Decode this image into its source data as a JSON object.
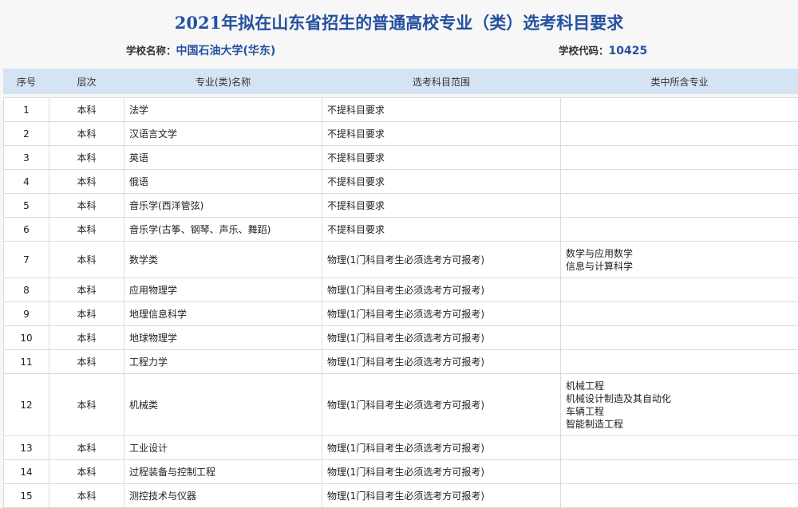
{
  "title": "2021年拟在山东省招生的普通高校专业（类）选考科目要求",
  "school": {
    "name_label": "学校名称：",
    "name": "中国石油大学(华东)",
    "code_label": "学校代码：",
    "code": "10425"
  },
  "headers": [
    "序号",
    "层次",
    "专业(类)名称",
    "选考科目范围",
    "类中所含专业"
  ],
  "rows": [
    {
      "no": "1",
      "level": "本科",
      "major": "法学",
      "req": "不提科目要求",
      "subs": []
    },
    {
      "no": "2",
      "level": "本科",
      "major": "汉语言文学",
      "req": "不提科目要求",
      "subs": []
    },
    {
      "no": "3",
      "level": "本科",
      "major": "英语",
      "req": "不提科目要求",
      "subs": []
    },
    {
      "no": "4",
      "level": "本科",
      "major": "俄语",
      "req": "不提科目要求",
      "subs": []
    },
    {
      "no": "5",
      "level": "本科",
      "major": "音乐学(西洋管弦)",
      "req": "不提科目要求",
      "subs": []
    },
    {
      "no": "6",
      "level": "本科",
      "major": "音乐学(古筝、钢琴、声乐、舞蹈)",
      "req": "不提科目要求",
      "subs": []
    },
    {
      "no": "7",
      "level": "本科",
      "major": "数学类",
      "req": "物理(1门科目考生必须选考方可报考)",
      "subs": [
        "数学与应用数学",
        "信息与计算科学"
      ]
    },
    {
      "no": "8",
      "level": "本科",
      "major": "应用物理学",
      "req": "物理(1门科目考生必须选考方可报考)",
      "subs": []
    },
    {
      "no": "9",
      "level": "本科",
      "major": "地理信息科学",
      "req": "物理(1门科目考生必须选考方可报考)",
      "subs": []
    },
    {
      "no": "10",
      "level": "本科",
      "major": "地球物理学",
      "req": "物理(1门科目考生必须选考方可报考)",
      "subs": []
    },
    {
      "no": "11",
      "level": "本科",
      "major": "工程力学",
      "req": "物理(1门科目考生必须选考方可报考)",
      "subs": []
    },
    {
      "no": "12",
      "level": "本科",
      "major": "机械类",
      "req": "物理(1门科目考生必须选考方可报考)",
      "subs": [
        "机械工程",
        "机械设计制造及其自动化",
        "车辆工程",
        "智能制造工程"
      ]
    },
    {
      "no": "13",
      "level": "本科",
      "major": "工业设计",
      "req": "物理(1门科目考生必须选考方可报考)",
      "subs": []
    },
    {
      "no": "14",
      "level": "本科",
      "major": "过程装备与控制工程",
      "req": "物理(1门科目考生必须选考方可报考)",
      "subs": []
    },
    {
      "no": "15",
      "level": "本科",
      "major": "测控技术与仪器",
      "req": "物理(1门科目考生必须选考方可报考)",
      "subs": []
    }
  ]
}
